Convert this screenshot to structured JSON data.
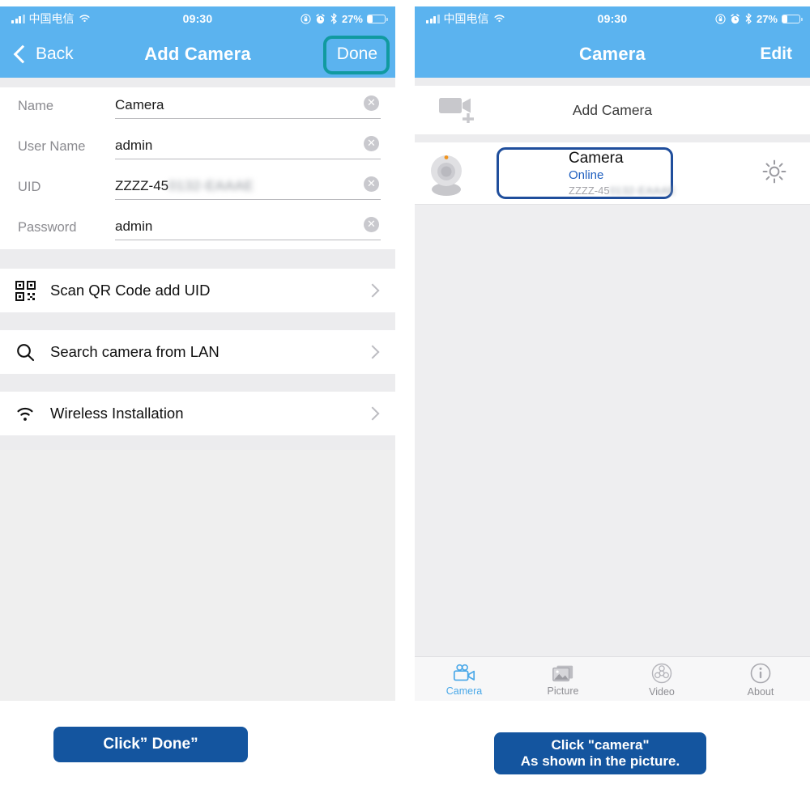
{
  "status_bar": {
    "carrier": "中国电信",
    "time": "09:30",
    "battery_percent": "27%",
    "icons": [
      "signal-bars-icon",
      "wifi-icon",
      "rotation-lock-icon",
      "alarm-clock-icon",
      "bluetooth-icon",
      "battery-icon"
    ]
  },
  "left_screen": {
    "nav": {
      "back_label": "Back",
      "title": "Add Camera",
      "done_label": "Done",
      "highlight_color": "#119aa0",
      "bar_color": "#5bb3ef"
    },
    "form": {
      "fields": [
        {
          "label": "Name",
          "value": "Camera",
          "value_blurred": "",
          "clear_icon": "clear-circle-icon"
        },
        {
          "label": "User Name",
          "value": "admin",
          "value_blurred": "",
          "clear_icon": "clear-circle-icon"
        },
        {
          "label": "UID",
          "value": "ZZZZ-45",
          "value_blurred": "0132-EAAAE",
          "clear_icon": "clear-circle-icon"
        },
        {
          "label": "Password",
          "value": "admin",
          "value_blurred": "",
          "clear_icon": "clear-circle-icon"
        }
      ]
    },
    "menu_items": [
      {
        "label": "Scan QR Code add UID",
        "icon": "qr-code-icon",
        "chevron": "chevron-right-icon"
      },
      {
        "label": "Search camera from LAN",
        "icon": "search-icon",
        "chevron": "chevron-right-icon"
      },
      {
        "label": "Wireless Installation",
        "icon": "wifi-icon",
        "chevron": "chevron-right-icon"
      }
    ]
  },
  "right_screen": {
    "nav": {
      "title": "Camera",
      "edit_label": "Edit",
      "bar_color": "#5bb3ef"
    },
    "add_camera_row": {
      "label": "Add Camera",
      "icon": "camcorder-plus-icon"
    },
    "camera_item": {
      "name": "Camera",
      "status": "Online",
      "uid_visible": "ZZZZ-45",
      "uid_blurred": "0132-EAAAE",
      "thumb_icon": "webcam-icon",
      "settings_icon": "gear-icon",
      "selection_color": "#1f4e9c",
      "status_color": "#1f5fbf"
    },
    "tabs": [
      {
        "label": "Camera",
        "icon": "camcorder-icon",
        "active": true
      },
      {
        "label": "Picture",
        "icon": "photos-icon",
        "active": false
      },
      {
        "label": "Video",
        "icon": "film-reel-icon",
        "active": false
      },
      {
        "label": "About",
        "icon": "info-icon",
        "active": false
      }
    ]
  },
  "callouts": {
    "left": {
      "text": "Click”  Done”",
      "color": "#14559f"
    },
    "right": {
      "line1": "Click \"camera\"",
      "line2": "As shown in the picture.",
      "color": "#14559f"
    }
  }
}
